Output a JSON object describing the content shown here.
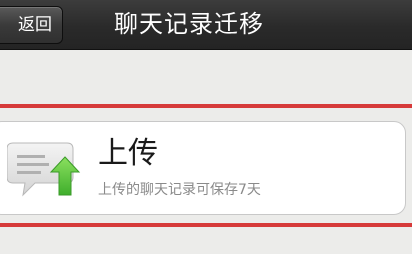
{
  "nav": {
    "back_label": "返回",
    "title": "聊天记录迁移"
  },
  "upload_option": {
    "title": "上传",
    "subtitle": "上传的聊天记录可保存7天",
    "icon": "chat-upload-icon"
  },
  "colors": {
    "nav_bg": "#2a2a2a",
    "page_bg": "#ececea",
    "highlight": "#d63a3a",
    "arrow_green": "#6cc94a"
  }
}
